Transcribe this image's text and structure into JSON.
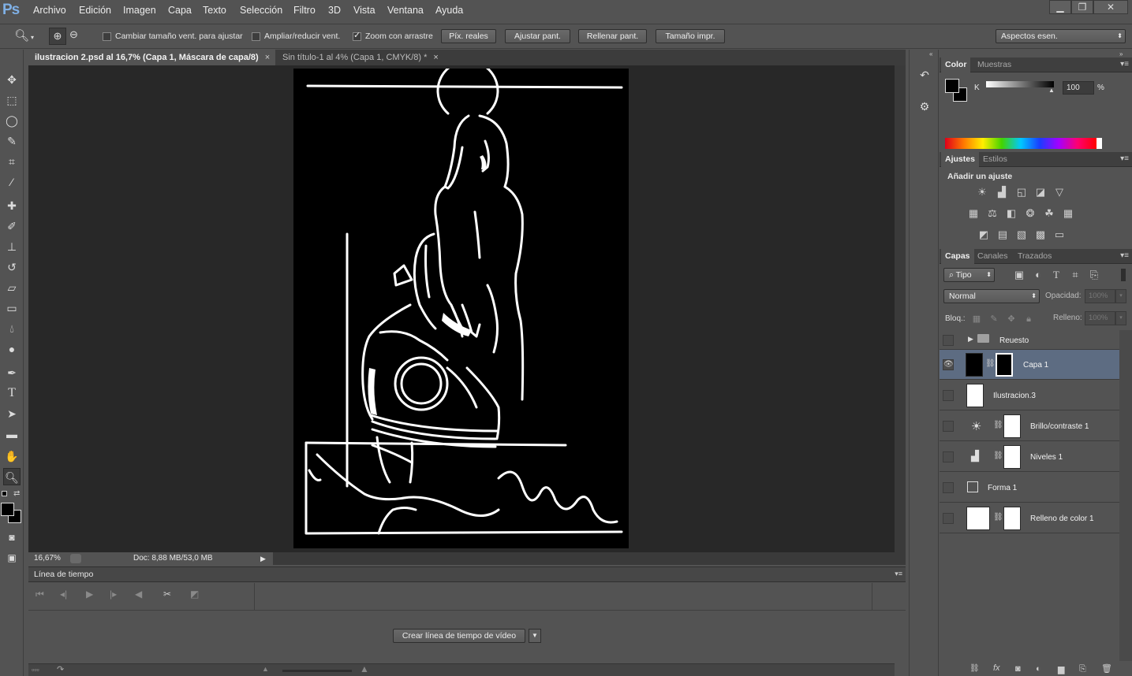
{
  "app": {
    "logo": "Ps"
  },
  "menu": [
    "Archivo",
    "Edición",
    "Imagen",
    "Capa",
    "Texto",
    "Selección",
    "Filtro",
    "3D",
    "Vista",
    "Ventana",
    "Ayuda"
  ],
  "window_buttons": [
    "▁",
    "❐",
    "✕"
  ],
  "options": {
    "resize_window": "Cambiar tamaño vent. para ajustar",
    "zoom_all": "Ampliar/reducir vent.",
    "scrubby_zoom": "Zoom con arrastre",
    "actual_pixels": "Píx. reales",
    "fit_screen": "Ajustar pant.",
    "fill_screen": "Rellenar pant.",
    "print_size": "Tamaño impr.",
    "workspace": "Aspectos esen."
  },
  "tabs": [
    {
      "label": "ilustracion 2.psd al 16,7% (Capa 1, Máscara de capa/8)",
      "close": "×"
    },
    {
      "label": "Sin título-1 al 4% (Capa 1, CMYK/8) *",
      "close": "×"
    }
  ],
  "status": {
    "zoom": "16,67%",
    "doc": "Doc: 8,88 MB/53,0 MB"
  },
  "timeline": {
    "title": "Línea de tiempo",
    "create_button": "Crear línea de tiempo de vídeo"
  },
  "color_panel": {
    "tabs": [
      "Color",
      "Muestras"
    ],
    "channel": "K",
    "value": "100",
    "unit": "%"
  },
  "adjust_panel": {
    "tabs": [
      "Ajustes",
      "Estilos"
    ],
    "heading": "Añadir un ajuste"
  },
  "layers_panel": {
    "tabs": [
      "Capas",
      "Canales",
      "Trazados"
    ],
    "filter": "Tipo",
    "blend_mode": "Normal",
    "opacity_label": "Opacidad:",
    "opacity_value": "100%",
    "lock_label": "Bloq.:",
    "fill_label": "Relleno:",
    "fill_value": "100%",
    "layers": [
      {
        "name": "Reuesto",
        "kind": "group"
      },
      {
        "name": "Capa 1",
        "kind": "masked",
        "selected": true
      },
      {
        "name": "Ilustracion.3",
        "kind": "image"
      },
      {
        "name": "Brillo/contraste 1",
        "kind": "adjust",
        "icon": "sun-icon"
      },
      {
        "name": "Niveles 1",
        "kind": "adjust",
        "icon": "levels-icon"
      },
      {
        "name": "Forma 1",
        "kind": "shape"
      },
      {
        "name": "Relleno de color 1",
        "kind": "fill"
      }
    ]
  },
  "colors": {
    "panel_bg": "#535353",
    "dark_bg": "#282828",
    "selected_layer": "#5d6c82",
    "logo": "#7fb0e6"
  }
}
